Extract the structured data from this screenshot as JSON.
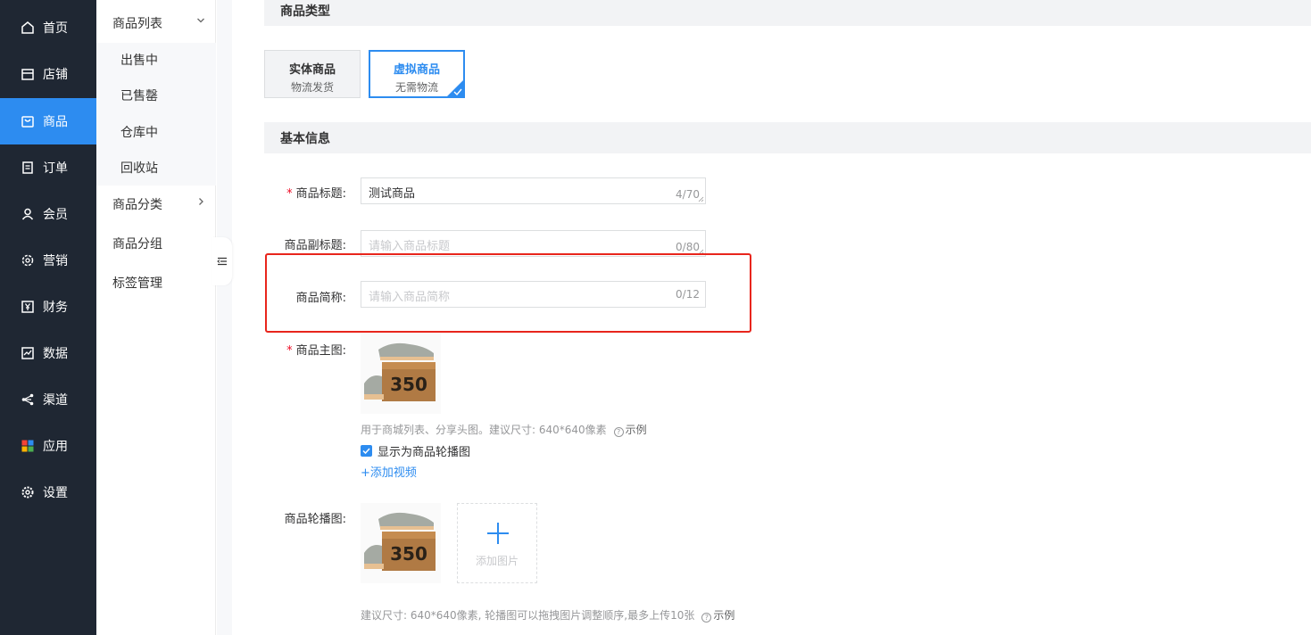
{
  "nav_primary": [
    {
      "label": "首页",
      "icon": "home-icon"
    },
    {
      "label": "店铺",
      "icon": "store-icon"
    },
    {
      "label": "商品",
      "icon": "bag-icon",
      "active": true
    },
    {
      "label": "订单",
      "icon": "order-icon"
    },
    {
      "label": "会员",
      "icon": "user-icon"
    },
    {
      "label": "营销",
      "icon": "gear-star-icon"
    },
    {
      "label": "财务",
      "icon": "yen-icon"
    },
    {
      "label": "数据",
      "icon": "chart-icon"
    },
    {
      "label": "渠道",
      "icon": "share-icon"
    },
    {
      "label": "应用",
      "icon": "apps-icon"
    },
    {
      "label": "设置",
      "icon": "settings-icon"
    }
  ],
  "nav_secondary": {
    "list_title": "商品列表",
    "list_items": [
      "出售中",
      "已售罄",
      "仓库中",
      "回收站"
    ],
    "category": "商品分类",
    "group": "商品分组",
    "tags": "标签管理"
  },
  "product_type": {
    "section_title": "商品类型",
    "physical": {
      "title": "实体商品",
      "desc": "物流发货"
    },
    "virtual": {
      "title": "虚拟商品",
      "desc": "无需物流",
      "selected": true
    }
  },
  "basic_info": {
    "section_title": "基本信息",
    "title_label": "商品标题:",
    "title_value": "测试商品",
    "title_count": "4/70",
    "subtitle_label": "商品副标题:",
    "subtitle_placeholder": "请输入商品标题",
    "subtitle_count": "0/80",
    "short_label": "商品简称:",
    "short_placeholder": "请输入商品简称",
    "short_count": "0/12",
    "main_image_label": "商品主图:",
    "main_image_help": "用于商城列表、分享头图。建议尺寸: 640*640像素",
    "example": "示例",
    "carousel_checkbox": "显示为商品轮播图",
    "add_video": "+添加视频",
    "carousel_label": "商品轮播图:",
    "add_image": "添加图片",
    "carousel_help": "建议尺寸: 640*640像素, 轮播图可以拖拽图片调整顺序,最多上传10张",
    "image_text": "350"
  },
  "colors": {
    "accent": "#2d8cf0",
    "nav_bg": "#1f2733",
    "highlight": "#e8251c",
    "required": "#ee0a24"
  }
}
